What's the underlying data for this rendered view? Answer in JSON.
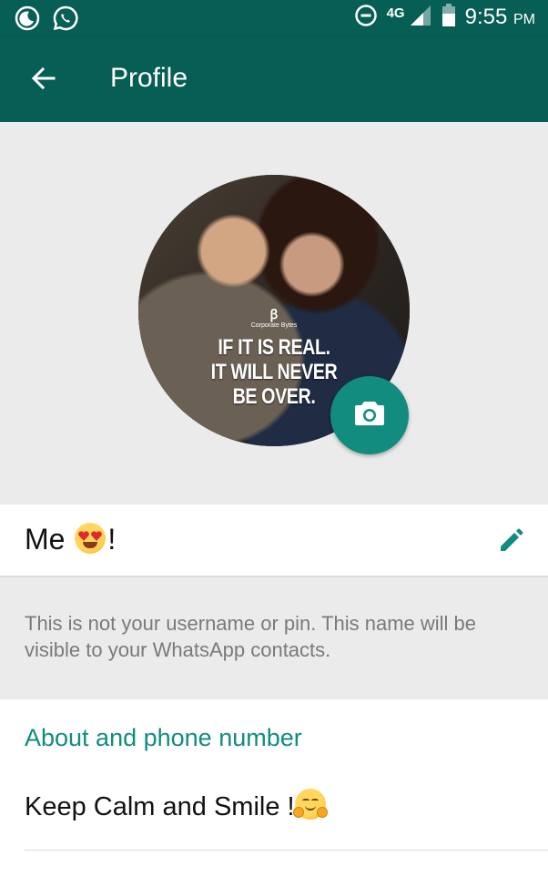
{
  "status_bar": {
    "network": "4G",
    "time": "9:55",
    "time_suffix": "PM",
    "icons": [
      "moon-icon",
      "whatsapp-icon",
      "data-saver-icon",
      "signal-icon",
      "battery-icon"
    ]
  },
  "app_bar": {
    "title": "Profile",
    "back_icon": "arrow-back-icon"
  },
  "profile_photo": {
    "logo_text": "Corporate Bytes",
    "quote_lines": [
      "IF IT IS REAL.",
      "IT WILL NEVER",
      "BE OVER."
    ],
    "camera_icon": "camera-icon"
  },
  "name": {
    "text": "Me",
    "emoji": "heart-eyes-emoji",
    "suffix": "!",
    "edit_icon": "pencil-icon"
  },
  "hint": "This is not your username or pin. This name will be visible to your WhatsApp contacts.",
  "about": {
    "header": "About and phone number",
    "value": "Keep Calm and Smile !",
    "emoji": "hugging-face-emoji"
  },
  "colors": {
    "primary_dark": "#075e54",
    "accent": "#128c7e",
    "background": "#ebebeb"
  }
}
